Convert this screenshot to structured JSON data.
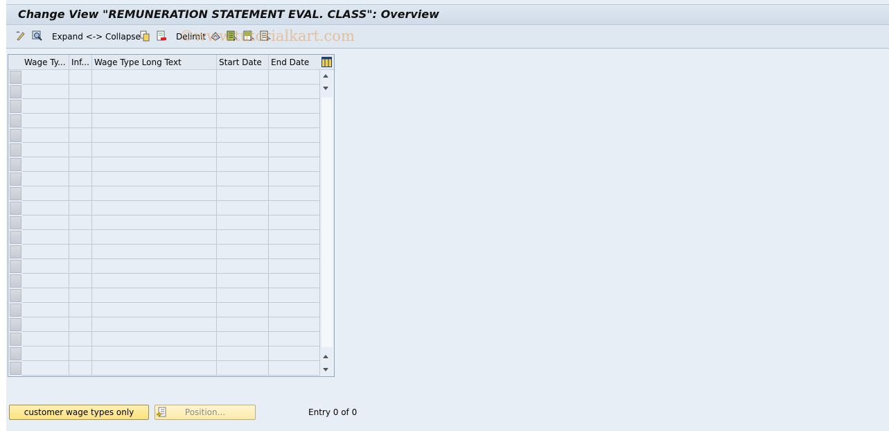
{
  "window": {
    "title": "Change View \"REMUNERATION STATEMENT EVAL. CLASS\": Overview"
  },
  "toolbar": {
    "items": [
      {
        "type": "icon",
        "name": "display-change-icon"
      },
      {
        "type": "icon",
        "name": "select-details-icon"
      },
      {
        "type": "text",
        "label": "Expand <-> Collapse"
      },
      {
        "type": "icon",
        "name": "copy-icon"
      },
      {
        "type": "icon",
        "name": "delete-icon"
      },
      {
        "type": "text",
        "label": "Delimit"
      },
      {
        "type": "icon",
        "name": "undo-change-icon"
      },
      {
        "type": "icon",
        "name": "select-all-icon"
      },
      {
        "type": "icon",
        "name": "select-block-icon"
      },
      {
        "type": "icon",
        "name": "deselect-all-icon"
      }
    ],
    "expand_collapse_label": "Expand <-> Collapse",
    "delimit_label": "Delimit",
    "watermark": "©www.tutorialkart.com"
  },
  "table": {
    "columns": [
      "Wage Ty...",
      "Inf...",
      "Wage Type Long Text",
      "Start Date",
      "End Date"
    ],
    "rows": [
      [
        "",
        "",
        "",
        "",
        ""
      ],
      [
        "",
        "",
        "",
        "",
        ""
      ],
      [
        "",
        "",
        "",
        "",
        ""
      ],
      [
        "",
        "",
        "",
        "",
        ""
      ],
      [
        "",
        "",
        "",
        "",
        ""
      ],
      [
        "",
        "",
        "",
        "",
        ""
      ],
      [
        "",
        "",
        "",
        "",
        ""
      ],
      [
        "",
        "",
        "",
        "",
        ""
      ],
      [
        "",
        "",
        "",
        "",
        ""
      ],
      [
        "",
        "",
        "",
        "",
        ""
      ],
      [
        "",
        "",
        "",
        "",
        ""
      ],
      [
        "",
        "",
        "",
        "",
        ""
      ],
      [
        "",
        "",
        "",
        "",
        ""
      ],
      [
        "",
        "",
        "",
        "",
        ""
      ],
      [
        "",
        "",
        "",
        "",
        ""
      ],
      [
        "",
        "",
        "",
        "",
        ""
      ],
      [
        "",
        "",
        "",
        "",
        ""
      ],
      [
        "",
        "",
        "",
        "",
        ""
      ],
      [
        "",
        "",
        "",
        "",
        ""
      ],
      [
        "",
        "",
        "",
        "",
        ""
      ],
      [
        "",
        "",
        "",
        "",
        ""
      ]
    ],
    "settings_icon": "table-settings-icon"
  },
  "footer": {
    "customer_button_label": "customer wage types only",
    "position_button_label": "Position...",
    "entry_text": "Entry 0 of 0"
  }
}
